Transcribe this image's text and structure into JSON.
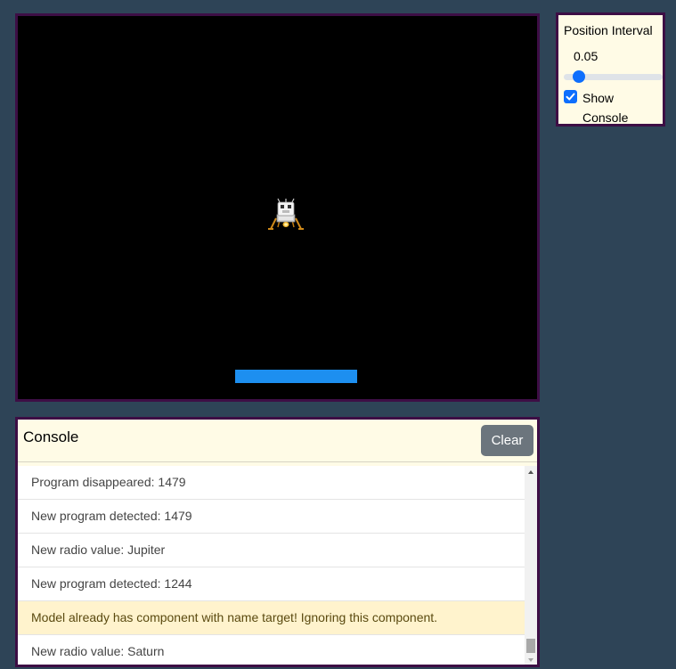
{
  "settings": {
    "title": "Position Interval",
    "value": "0.05",
    "slider_fraction": 0.05,
    "show_console_label": "Show Console",
    "show_console_checked": true
  },
  "game": {
    "lander_icon": "lunar-lander-icon",
    "platform_color": "#1d8ff0"
  },
  "console": {
    "title": "Console",
    "clear_label": "Clear",
    "entries": [
      {
        "text": "Program disappeared: 1479",
        "level": "info"
      },
      {
        "text": "New program detected: 1479",
        "level": "info"
      },
      {
        "text": "New radio value: Jupiter",
        "level": "info"
      },
      {
        "text": "New program detected: 1244",
        "level": "info"
      },
      {
        "text": "Model already has component with name target! Ignoring this component.",
        "level": "warning"
      },
      {
        "text": "New radio value: Saturn",
        "level": "info"
      }
    ]
  },
  "colors": {
    "background": "#2e4457",
    "border": "#3d0e45",
    "panel": "#fffbe6",
    "accent": "#0d6efd",
    "warning_bg": "#fff3cd"
  }
}
